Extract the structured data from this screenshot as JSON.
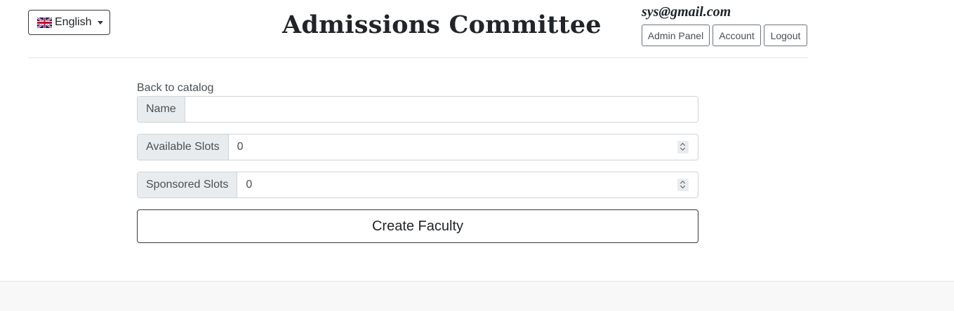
{
  "header": {
    "language": "English",
    "title": "Admissions Committee",
    "user_email": "sys@gmail.com",
    "nav": {
      "admin_panel": "Admin Panel",
      "account": "Account",
      "logout": "Logout"
    }
  },
  "form": {
    "back_link": "Back to catalog",
    "fields": [
      {
        "label": "Name",
        "value": ""
      },
      {
        "label": "Available Slots",
        "value": "0"
      },
      {
        "label": "Sponsored Slots",
        "value": "0"
      }
    ],
    "submit_label": "Create Faculty"
  }
}
